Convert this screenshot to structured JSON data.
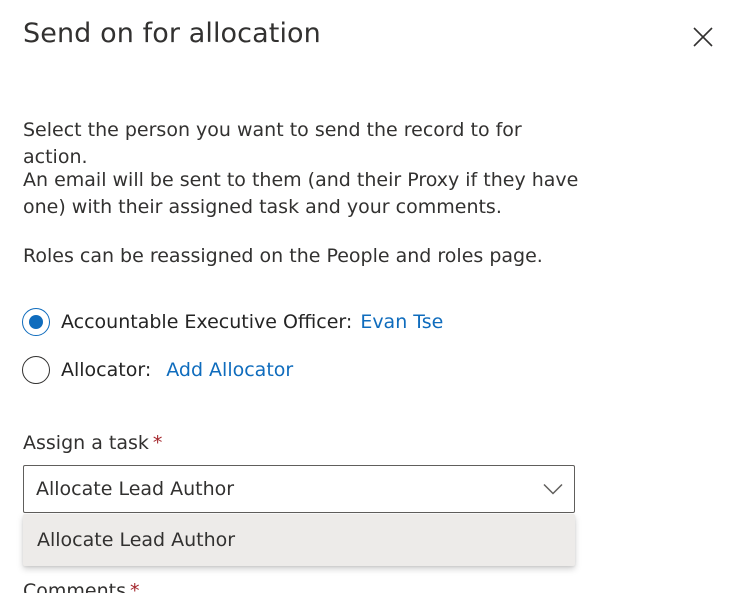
{
  "dialog": {
    "title": "Send on for allocation",
    "close_icon": "close-icon"
  },
  "intro": {
    "line1": "Select the person you want to send the record to for action.",
    "line2": "An email will be sent to them (and their Proxy if they have one) with their assigned task and your comments.",
    "line3": "Roles can be reassigned on the People and roles page."
  },
  "recipients": [
    {
      "label": "Accountable Executive Officer:",
      "link": "Evan Tse",
      "selected": true
    },
    {
      "label": "Allocator:",
      "link": "Add Allocator",
      "selected": false
    }
  ],
  "task": {
    "label": "Assign a task",
    "required_marker": "*",
    "selected_value": "Allocate Lead Author",
    "chevron_icon": "chevron-down-icon",
    "options": [
      "Allocate Lead Author"
    ]
  },
  "comments": {
    "label": "Comments",
    "required_marker": "*"
  },
  "colors": {
    "accent": "#0f6cbd",
    "required": "#a4262c",
    "text": "#323130",
    "menu_bg": "#edebe9"
  }
}
